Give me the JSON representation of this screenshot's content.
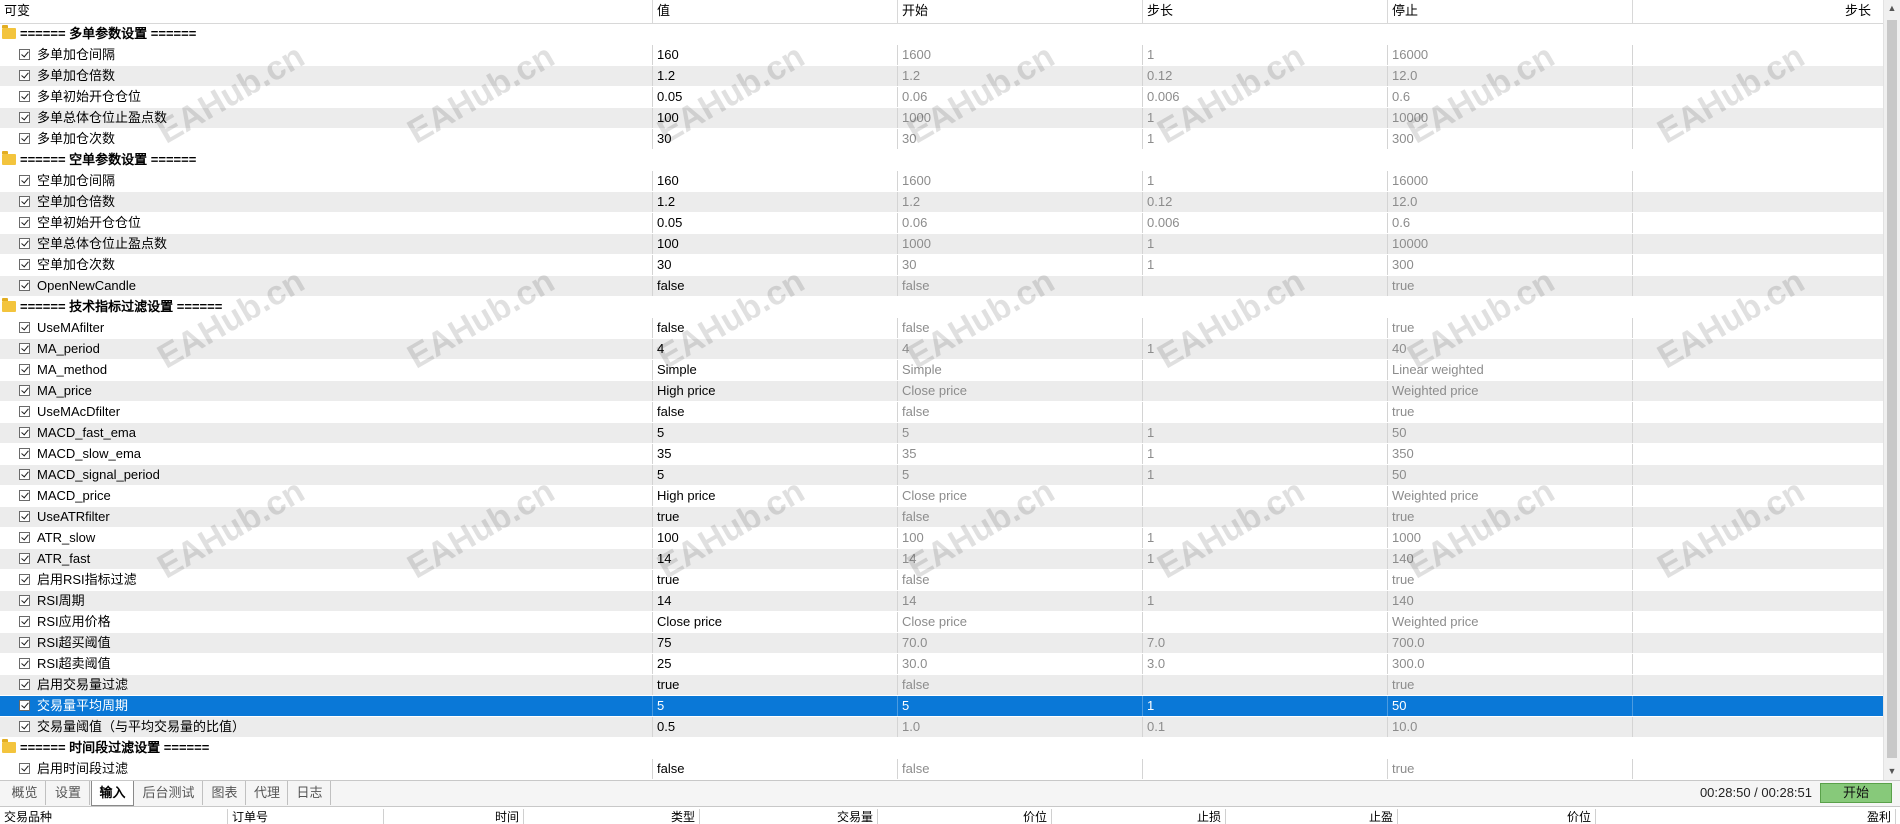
{
  "header": {
    "columns": [
      "可变",
      "值",
      "开始",
      "步长",
      "停止",
      "步长"
    ]
  },
  "watermark": "EAHub.cn",
  "rows": [
    {
      "type": "group",
      "label": "====== 多单参数设置 ======"
    },
    {
      "name": "多单加仓间隔",
      "value": "160",
      "start": "1600",
      "step": "1",
      "stop": "16000"
    },
    {
      "name": "多单加仓倍数",
      "value": "1.2",
      "start": "1.2",
      "step": "0.12",
      "stop": "12.0"
    },
    {
      "name": "多单初始开仓仓位",
      "value": "0.05",
      "start": "0.06",
      "step": "0.006",
      "stop": "0.6"
    },
    {
      "name": "多单总体仓位止盈点数",
      "value": "100",
      "start": "1000",
      "step": "1",
      "stop": "10000"
    },
    {
      "name": "多单加仓次数",
      "value": "30",
      "start": "30",
      "step": "1",
      "stop": "300"
    },
    {
      "type": "group",
      "label": "====== 空单参数设置 ======"
    },
    {
      "name": "空单加仓间隔",
      "value": "160",
      "start": "1600",
      "step": "1",
      "stop": "16000"
    },
    {
      "name": "空单加仓倍数",
      "value": "1.2",
      "start": "1.2",
      "step": "0.12",
      "stop": "12.0"
    },
    {
      "name": "空单初始开仓仓位",
      "value": "0.05",
      "start": "0.06",
      "step": "0.006",
      "stop": "0.6"
    },
    {
      "name": "空单总体仓位止盈点数",
      "value": "100",
      "start": "1000",
      "step": "1",
      "stop": "10000"
    },
    {
      "name": "空单加仓次数",
      "value": "30",
      "start": "30",
      "step": "1",
      "stop": "300"
    },
    {
      "name": "OpenNewCandle",
      "value": "false",
      "start": "false",
      "step": "",
      "stop": "true"
    },
    {
      "type": "group",
      "label": "====== 技术指标过滤设置 ======"
    },
    {
      "name": "UseMAfilter",
      "value": "false",
      "start": "false",
      "step": "",
      "stop": "true"
    },
    {
      "name": "MA_period",
      "value": "4",
      "start": "4",
      "step": "1",
      "stop": "40"
    },
    {
      "name": "MA_method",
      "value": "Simple",
      "start": "Simple",
      "step": "",
      "stop": "Linear weighted"
    },
    {
      "name": "MA_price",
      "value": "High price",
      "start": "Close price",
      "step": "",
      "stop": "Weighted price"
    },
    {
      "name": "UseMAcDfilter",
      "value": "false",
      "start": "false",
      "step": "",
      "stop": "true"
    },
    {
      "name": "MACD_fast_ema",
      "value": "5",
      "start": "5",
      "step": "1",
      "stop": "50"
    },
    {
      "name": "MACD_slow_ema",
      "value": "35",
      "start": "35",
      "step": "1",
      "stop": "350"
    },
    {
      "name": "MACD_signal_period",
      "value": "5",
      "start": "5",
      "step": "1",
      "stop": "50"
    },
    {
      "name": "MACD_price",
      "value": "High price",
      "start": "Close price",
      "step": "",
      "stop": "Weighted price"
    },
    {
      "name": "UseATRfilter",
      "value": "true",
      "start": "false",
      "step": "",
      "stop": "true"
    },
    {
      "name": "ATR_slow",
      "value": "100",
      "start": "100",
      "step": "1",
      "stop": "1000"
    },
    {
      "name": "ATR_fast",
      "value": "14",
      "start": "14",
      "step": "1",
      "stop": "140"
    },
    {
      "name": "启用RSI指标过滤",
      "value": "true",
      "start": "false",
      "step": "",
      "stop": "true"
    },
    {
      "name": "RSI周期",
      "value": "14",
      "start": "14",
      "step": "1",
      "stop": "140"
    },
    {
      "name": "RSI应用价格",
      "value": "Close price",
      "start": "Close price",
      "step": "",
      "stop": "Weighted price"
    },
    {
      "name": "RSI超买阈值",
      "value": "75",
      "start": "70.0",
      "step": "7.0",
      "stop": "700.0"
    },
    {
      "name": "RSI超卖阈值",
      "value": "25",
      "start": "30.0",
      "step": "3.0",
      "stop": "300.0"
    },
    {
      "name": "启用交易量过滤",
      "value": "true",
      "start": "false",
      "step": "",
      "stop": "true"
    },
    {
      "name": "交易量平均周期",
      "value": "5",
      "start": "5",
      "step": "1",
      "stop": "50",
      "selected": true
    },
    {
      "name": "交易量阈值（与平均交易量的比值）",
      "value": "0.5",
      "start": "1.0",
      "step": "0.1",
      "stop": "10.0"
    },
    {
      "type": "group",
      "label": "====== 时间段过滤设置 ======"
    },
    {
      "name": "启用时间段过滤",
      "value": "false",
      "start": "false",
      "step": "",
      "stop": "true"
    }
  ],
  "tabs": [
    {
      "label": "概览"
    },
    {
      "label": "设置"
    },
    {
      "label": "输入",
      "active": true
    },
    {
      "label": "后台测试"
    },
    {
      "label": "图表"
    },
    {
      "label": "代理"
    },
    {
      "label": "日志"
    }
  ],
  "status": {
    "clock": "00:28:50 / 00:28:51",
    "start_button": "开始"
  },
  "lower_header": [
    "交易品种",
    "订单号",
    "时间",
    "类型",
    "交易量",
    "价位",
    "止损",
    "止盈",
    "价位",
    "盈利"
  ],
  "colors": {
    "selection": "#0a78d7",
    "start_button": "#87c97a",
    "folder": "#f3c43d"
  }
}
